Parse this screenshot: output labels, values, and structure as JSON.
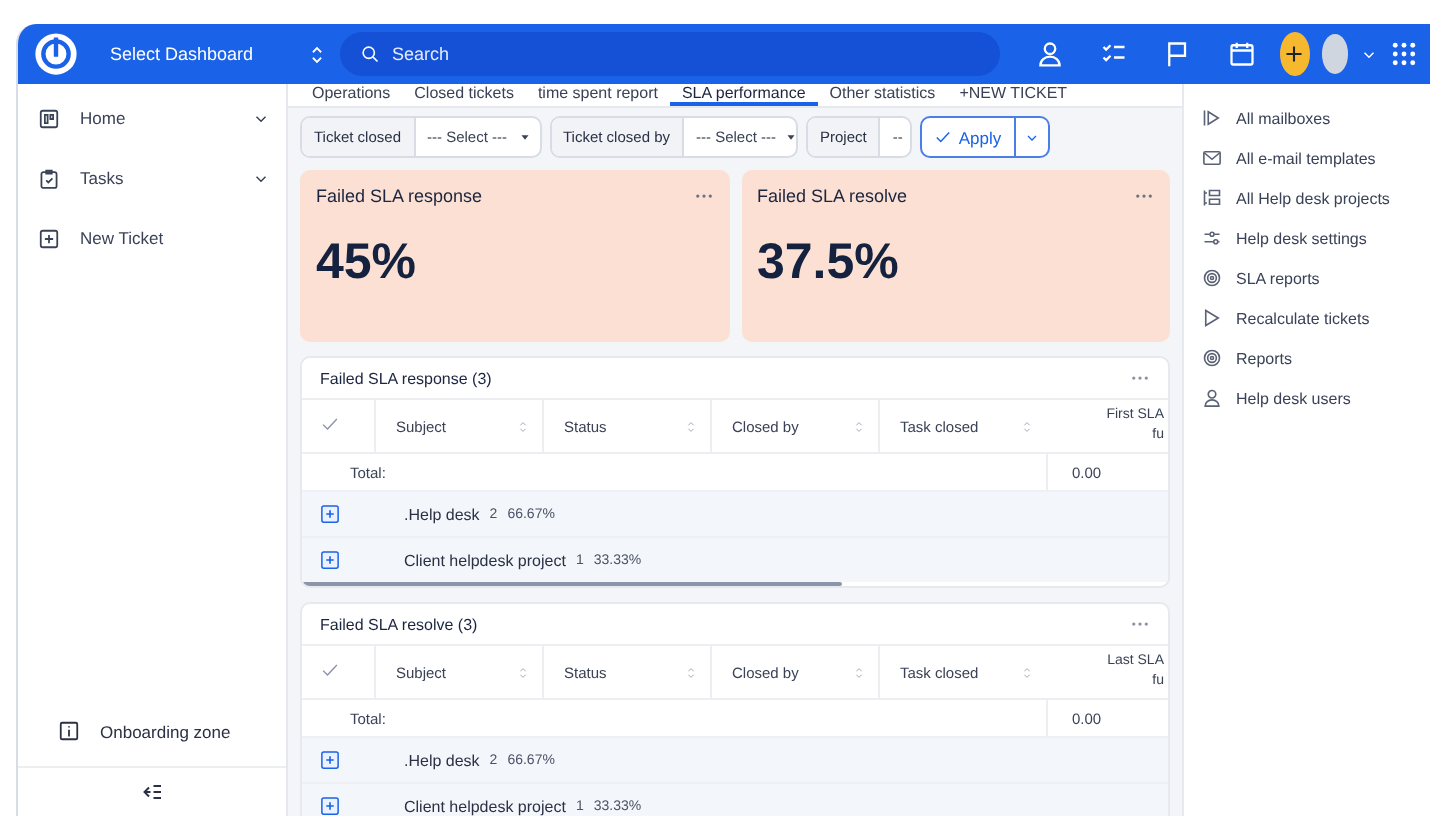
{
  "topbar": {
    "dashboard": "Select Dashboard",
    "search": {
      "placeholder": "Search"
    }
  },
  "sidebar": {
    "items": [
      {
        "label": "Home",
        "expandable": true
      },
      {
        "label": "Tasks",
        "expandable": true
      },
      {
        "label": "New Ticket",
        "expandable": false
      }
    ],
    "footer": "Onboarding zone"
  },
  "tabs": [
    {
      "label": "Operations",
      "selected": false
    },
    {
      "label": "Closed tickets",
      "selected": false
    },
    {
      "label": "time spent report",
      "selected": false
    },
    {
      "label": "SLA performance",
      "selected": true
    },
    {
      "label": "Other statistics",
      "selected": false
    },
    {
      "label": "+NEW TICKET",
      "selected": false
    }
  ],
  "filters": [
    {
      "label": "Ticket closed",
      "value": "--- Select ---"
    },
    {
      "label": "Ticket closed by",
      "value": "--- Select ---"
    },
    {
      "label": "Project",
      "value": "--"
    }
  ],
  "apply": "Apply",
  "kpis": [
    {
      "title": "Failed SLA response",
      "value": "45%"
    },
    {
      "title": "Failed SLA resolve",
      "value": "37.5%"
    }
  ],
  "tables": [
    {
      "title": "Failed SLA response (3)",
      "columns": [
        "Subject",
        "Status",
        "Closed by",
        "Task closed"
      ],
      "last_column": [
        "First SLA",
        "fu"
      ],
      "total_label": "Total:",
      "total_value": "0.00",
      "groups": [
        {
          "name": ".Help desk",
          "count": "2",
          "share": "66.67%",
          "expanded": false
        },
        {
          "name": "Client helpdesk project",
          "count": "1",
          "share": "33.33%",
          "expanded": false
        }
      ]
    },
    {
      "title": "Failed SLA resolve (3)",
      "columns": [
        "Subject",
        "Status",
        "Closed by",
        "Task closed"
      ],
      "last_column": [
        "Last SLA",
        "fu"
      ],
      "total_label": "Total:",
      "total_value": "0.00",
      "groups": [
        {
          "name": ".Help desk",
          "count": "2",
          "share": "66.67%",
          "expanded": false
        },
        {
          "name": "Client helpdesk project",
          "count": "1",
          "share": "33.33%",
          "expanded": false
        }
      ]
    }
  ],
  "side_menu": [
    {
      "label": "All mailboxes"
    },
    {
      "label": "All e-mail templates"
    },
    {
      "label": "All Help desk projects"
    },
    {
      "label": "Help desk settings"
    },
    {
      "label": "SLA reports"
    },
    {
      "label": "Recalculate tickets"
    },
    {
      "label": "Reports"
    },
    {
      "label": "Help desk users"
    }
  ]
}
